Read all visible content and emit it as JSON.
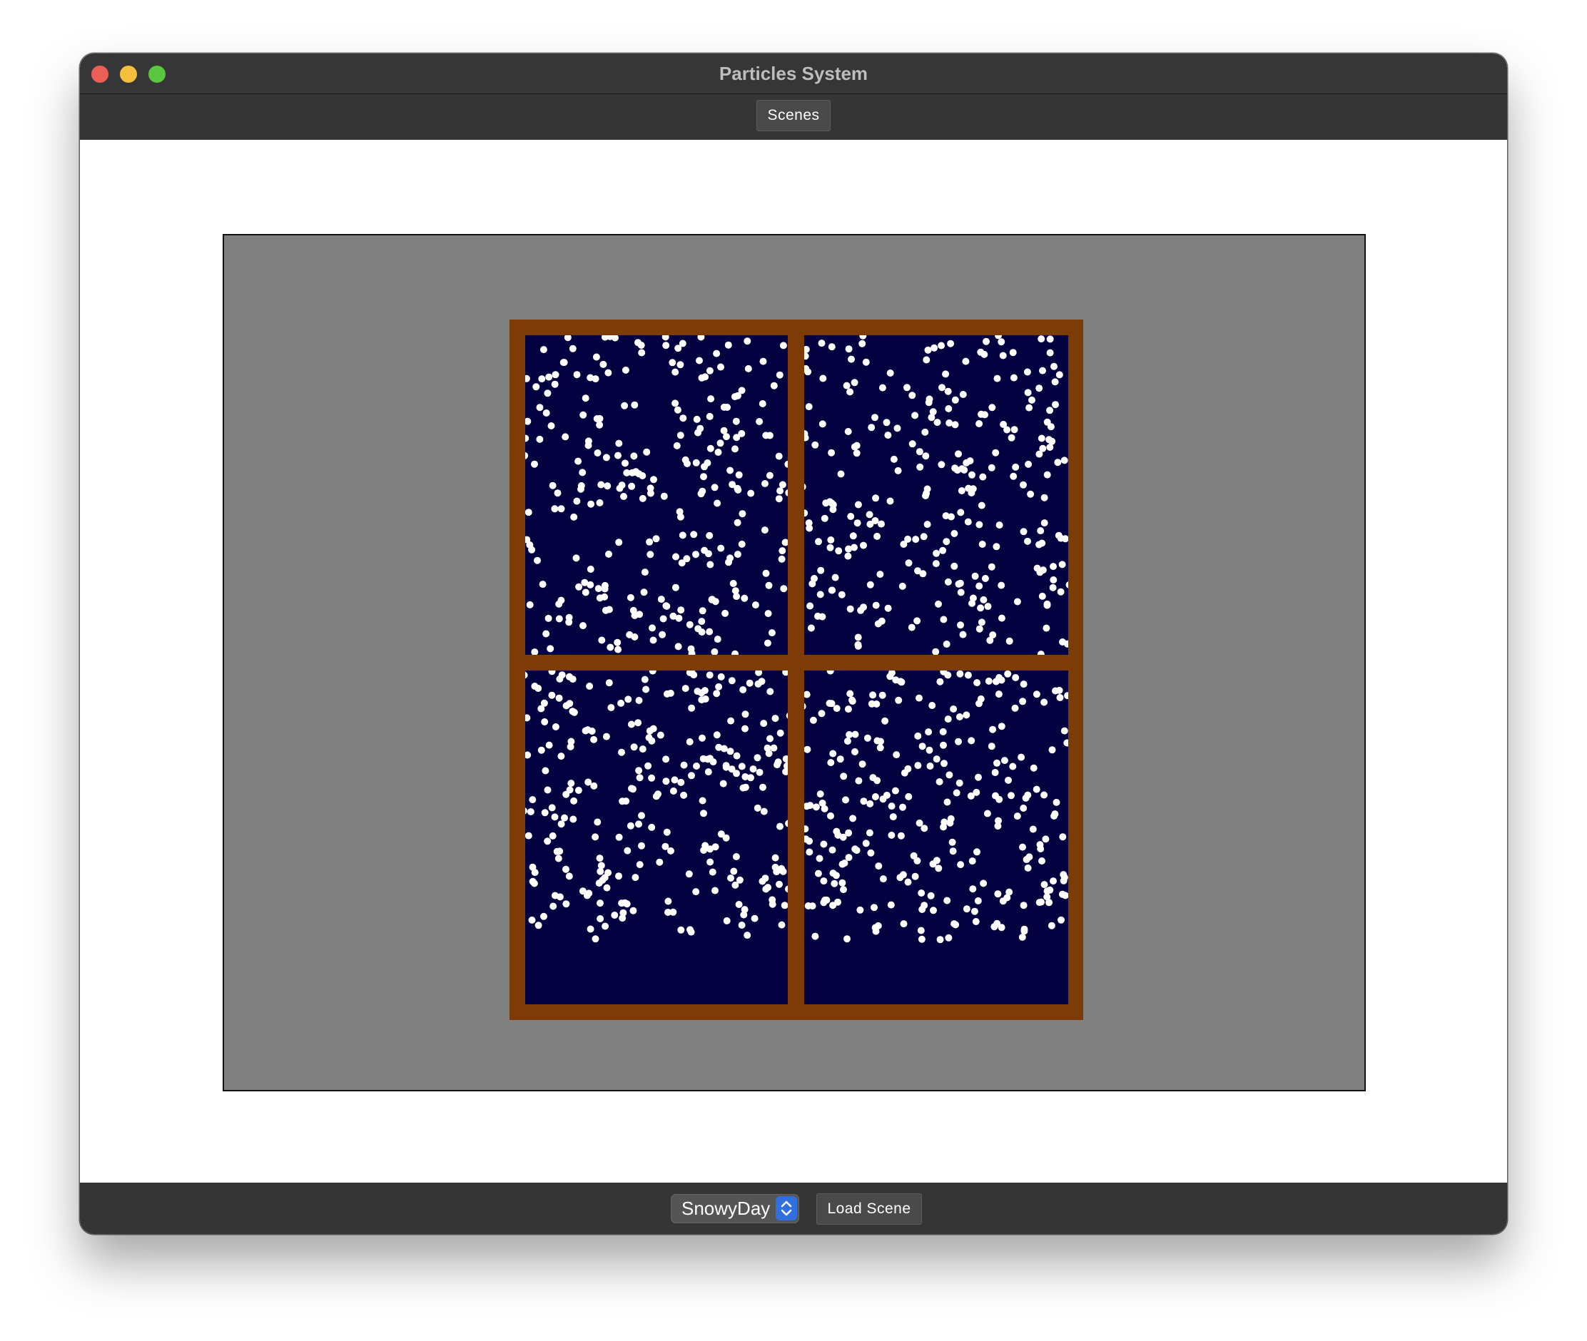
{
  "window": {
    "title": "Particles System",
    "controls": [
      "close",
      "minimize",
      "zoom"
    ]
  },
  "toolbar": {
    "scenes_label": "Scenes"
  },
  "scene": {
    "background_color": "#808080",
    "window_frame_color": "#7d3c05",
    "night_sky_color": "#03013f",
    "particle_color": "#ffffff"
  },
  "bottombar": {
    "scene_select_value": "SnowyDay",
    "load_scene_label": "Load Scene"
  },
  "icons": {
    "select_arrows": "chevron-up-down-icon"
  }
}
